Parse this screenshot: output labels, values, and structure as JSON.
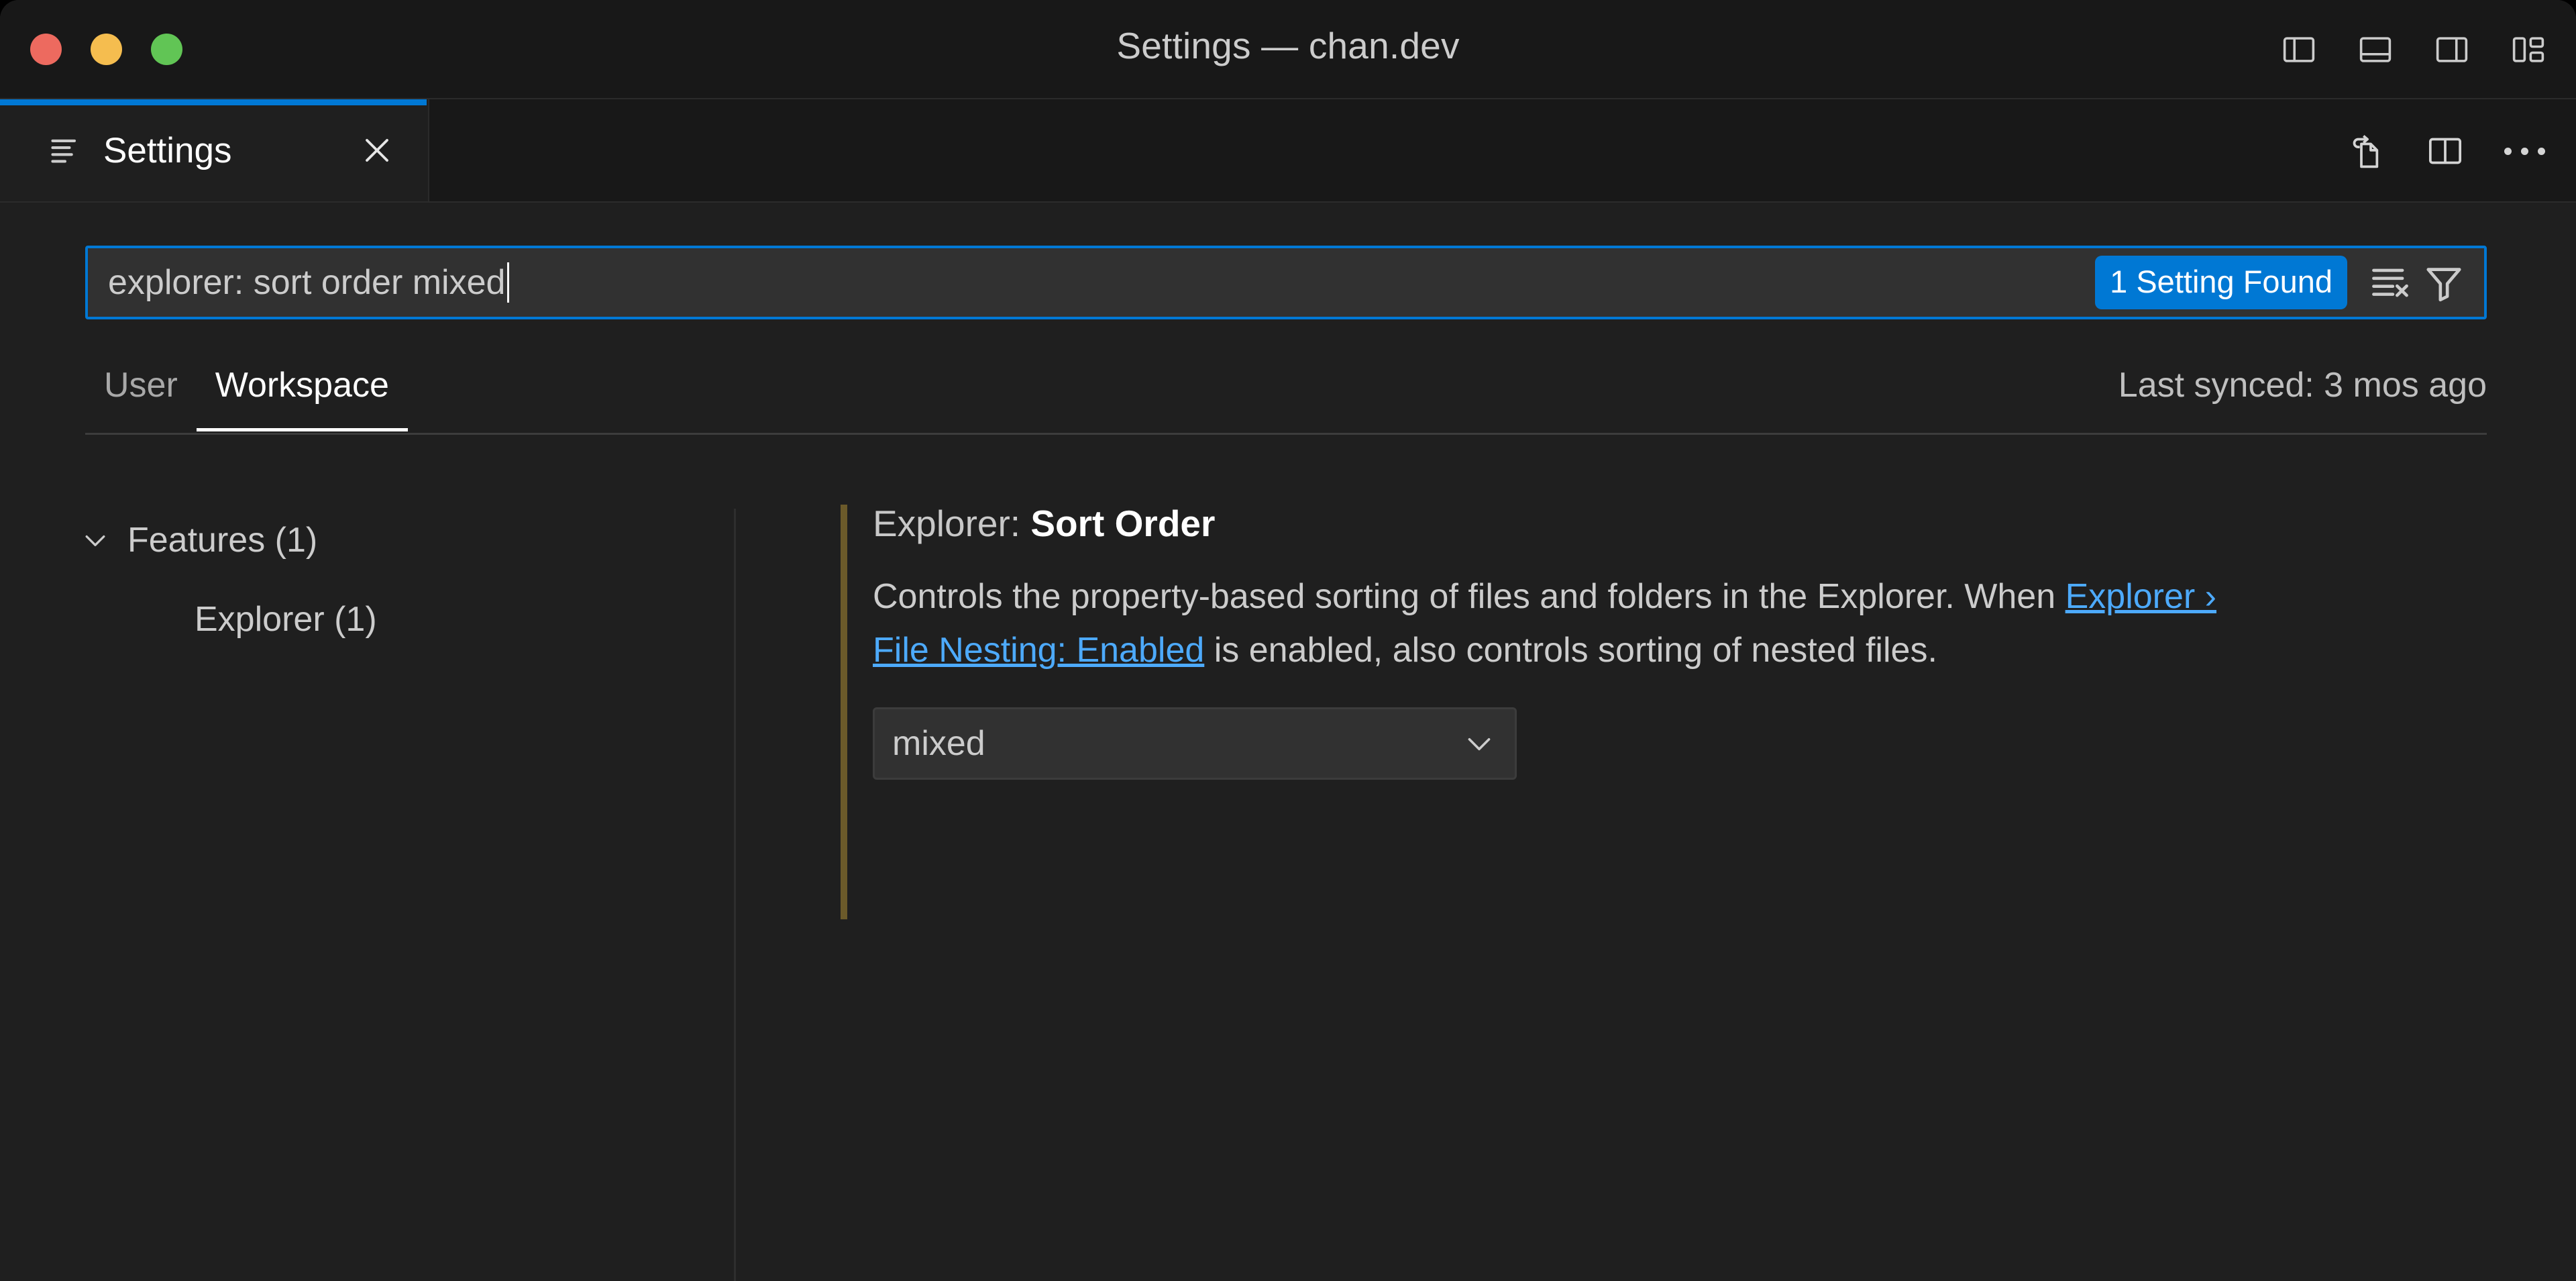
{
  "window": {
    "title": "Settings — chan.dev",
    "traffic_lights": [
      {
        "name": "close",
        "color": "#ed6a5f"
      },
      {
        "name": "minimize",
        "color": "#f5bd4f"
      },
      {
        "name": "maximize",
        "color": "#61c555"
      }
    ],
    "layout_actions": [
      {
        "name": "toggle-primary-sidebar",
        "icon": "layout-sidebar-left-icon"
      },
      {
        "name": "toggle-panel",
        "icon": "layout-panel-icon"
      },
      {
        "name": "toggle-secondary-sidebar",
        "icon": "layout-sidebar-right-icon"
      },
      {
        "name": "customize-layout",
        "icon": "layout-customize-icon"
      }
    ]
  },
  "tab": {
    "label": "Settings",
    "icon": "settings-list-icon",
    "close_icon": "close-icon",
    "active_border_color": "#0078d4"
  },
  "editor_actions": [
    {
      "name": "open-settings-json",
      "icon": "open-file-icon"
    },
    {
      "name": "split-editor",
      "icon": "split-editor-icon"
    },
    {
      "name": "more-actions",
      "icon": "ellipsis-icon"
    }
  ],
  "search": {
    "value": "explorer: sort order mixed",
    "placeholder": "Search settings",
    "results_badge": "1 Setting Found",
    "badge_color": "#0078d4",
    "clear_icon": "clear-search-results-icon",
    "filter_icon": "filter-icon"
  },
  "scope": {
    "tabs": [
      {
        "label": "User",
        "active": false
      },
      {
        "label": "Workspace",
        "active": true
      }
    ],
    "last_synced": "Last synced: 3 mos ago"
  },
  "toc": {
    "items": [
      {
        "label": "Features (1)",
        "level": 0,
        "expanded": true
      },
      {
        "label": "Explorer (1)",
        "level": 1,
        "expanded": null
      }
    ]
  },
  "setting": {
    "category": "Explorer: ",
    "name": "Sort Order",
    "modified_indicator_color": "#6b5a2a",
    "description_part1": "Controls the property-based sorting of files and folders in the Explorer. When ",
    "description_link": "Explorer › File Nesting: Enabled",
    "description_part2": " is enabled, also controls sorting of nested files.",
    "link_color": "#4daafc",
    "value": "mixed",
    "chevron_icon": "chevron-down-icon"
  }
}
